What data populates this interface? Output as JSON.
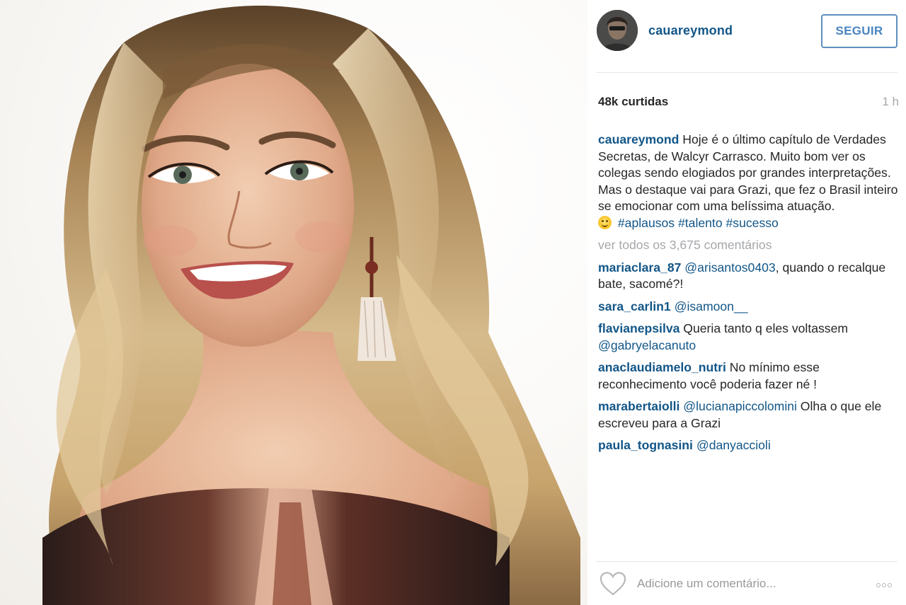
{
  "post": {
    "image_alt": "Foto de Grazi"
  },
  "header": {
    "username": "cauareymond",
    "follow_label": "SEGUIR"
  },
  "stats": {
    "likes": "48k curtidas",
    "time": "1 h"
  },
  "caption": {
    "username": "cauareymond",
    "text": "Hoje é o último capítulo de Verdades Secretas, de Walcyr Carrasco. Muito bom ver os colegas sendo elogiados por grandes interpretações. Mas o destaque vai para Grazi, que fez o Brasil inteiro se emocionar com uma belíssima atuação.",
    "hashtags": [
      "#aplausos",
      "#talento",
      "#sucesso"
    ]
  },
  "view_all_comments": "ver todos os 3,675 comentários",
  "comments": [
    {
      "user": "mariaclara_87",
      "mention": "@arisantos0403",
      "text": ", quando o recalque bate, sacomé?!"
    },
    {
      "user": "sara_carlin1",
      "mention": "@isamoon__",
      "text": ""
    },
    {
      "user": "flavianepsilva",
      "mention": "",
      "text": "Queria tanto q eles voltassem ",
      "trailing_mention": "@gabryelacanuto"
    },
    {
      "user": "anaclaudiamelo_nutri",
      "mention": "",
      "text": "No mínimo esse reconhecimento você poderia fazer né !"
    },
    {
      "user": "marabertaiolli",
      "mention": "@lucianapiccolomini",
      "text": " Olha o que ele escreveu para a Grazi"
    },
    {
      "user": "paula_tognasini",
      "mention": "@danyaccioli",
      "text": ""
    }
  ],
  "footer": {
    "comment_placeholder": "Adicione um comentário...",
    "like_icon": "heart-outline-icon",
    "more_icon": "ellipsis-icon"
  },
  "colors": {
    "username": "#125688",
    "follow_border": "#5e8fbf",
    "muted": "#a5a7aa"
  }
}
